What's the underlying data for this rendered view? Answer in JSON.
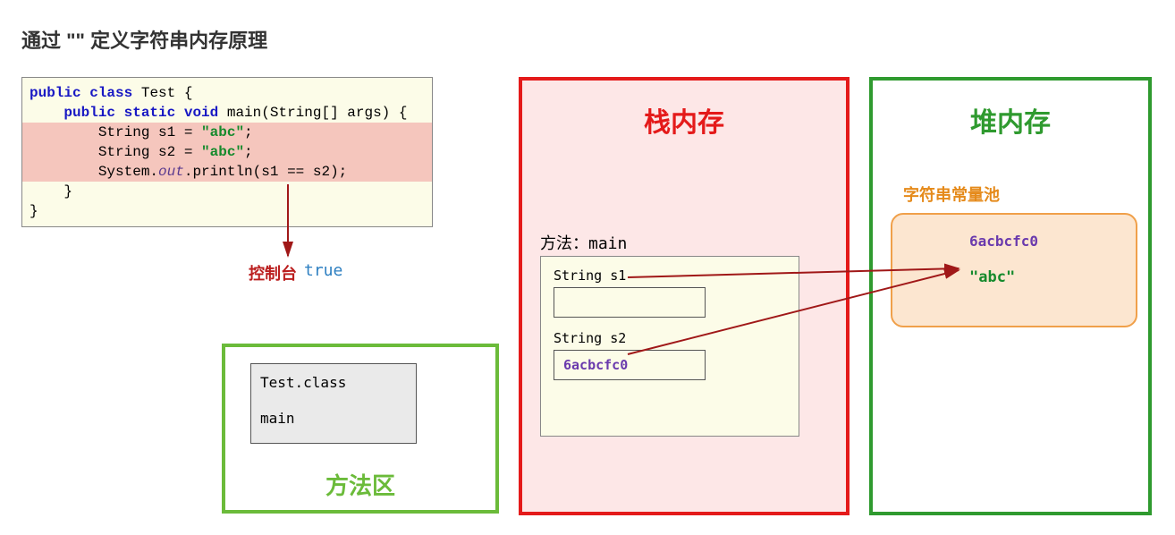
{
  "title": "通过 \"\" 定义字符串内存原理",
  "code": {
    "l1a": "public",
    "l1b": "class",
    "l1c": " Test {",
    "l2a": "public",
    "l2b": "static",
    "l2c": "void",
    "l2d": " main(String[] args) {",
    "l3a": "        String s1 = ",
    "l3b": "\"abc\"",
    "l3c": ";",
    "l4a": "        String s2 = ",
    "l4b": "\"abc\"",
    "l4c": ";",
    "l5a": "        System.",
    "l5b": "out",
    "l5c": ".println(s1 == s2);",
    "l6": "    }",
    "l7": "}"
  },
  "console": {
    "label": "控制台",
    "value": "true"
  },
  "methodArea": {
    "title": "方法区",
    "className": "Test.class",
    "methodName": "main"
  },
  "stack": {
    "title": "栈内存",
    "methodLabel": "方法：main",
    "var1": "String s1",
    "var1val": "",
    "var2": "String s2",
    "var2val": "6acbcfc0"
  },
  "heap": {
    "title": "堆内存",
    "poolLabel": "字符串常量池",
    "addr": "6acbcfc0",
    "val": "\"abc\""
  }
}
